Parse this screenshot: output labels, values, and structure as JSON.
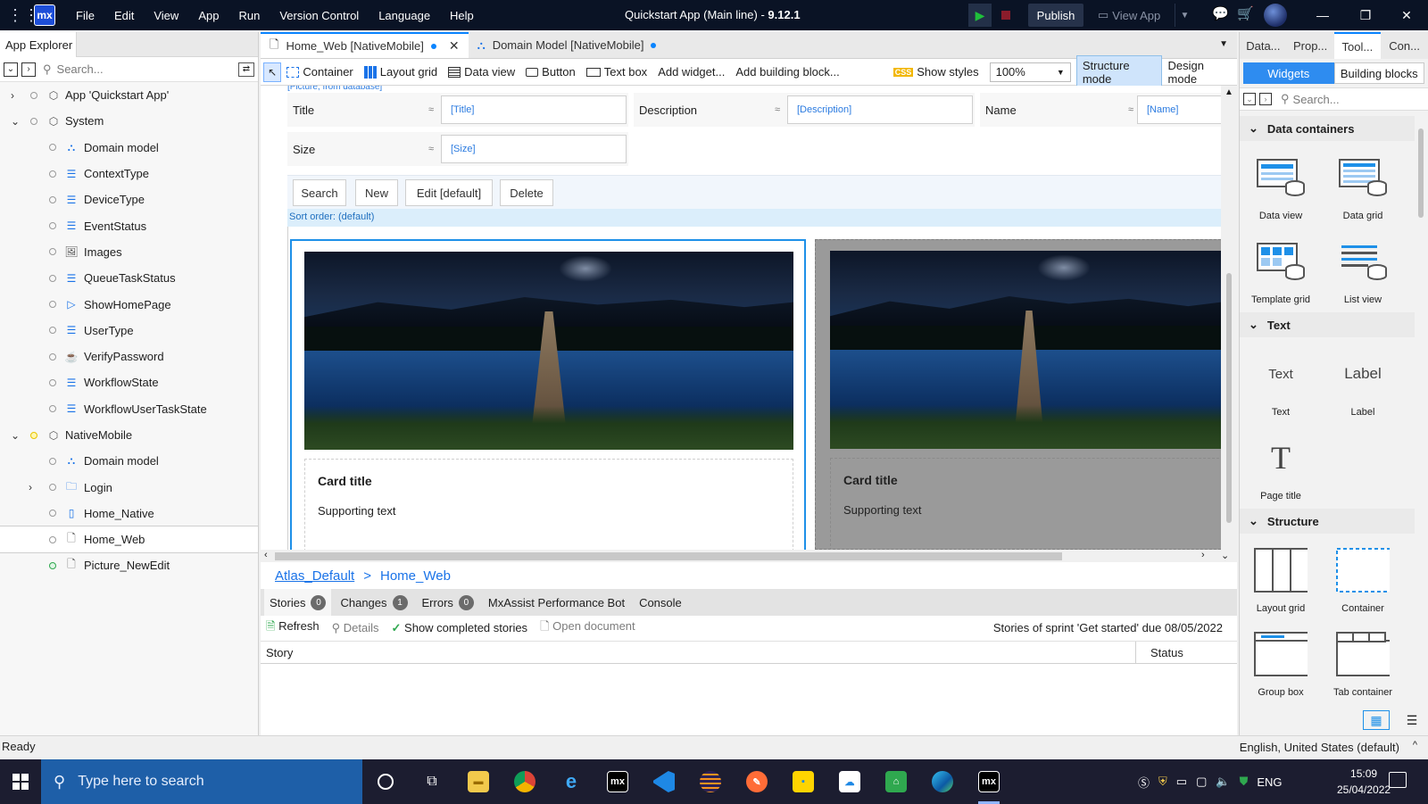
{
  "titlebar": {
    "logo": "mx",
    "menu": [
      "File",
      "Edit",
      "View",
      "App",
      "Run",
      "Version Control",
      "Language",
      "Help"
    ],
    "app_title": "Quickstart App (Main line)",
    "version": "9.12.1",
    "publish": "Publish",
    "view_app": "View App"
  },
  "explorer": {
    "tab": "App Explorer",
    "search_placeholder": "Search...",
    "items": [
      {
        "label": "App 'Quickstart App'",
        "icon": "app-icon"
      },
      {
        "label": "System",
        "icon": "module-icon"
      },
      {
        "label": "Domain model",
        "icon": "domain-model-icon"
      },
      {
        "label": "ContextType",
        "icon": "enumeration-icon"
      },
      {
        "label": "DeviceType",
        "icon": "enumeration-icon"
      },
      {
        "label": "EventStatus",
        "icon": "enumeration-icon"
      },
      {
        "label": "Images",
        "icon": "image-collection-icon"
      },
      {
        "label": "QueueTaskStatus",
        "icon": "enumeration-icon"
      },
      {
        "label": "ShowHomePage",
        "icon": "microflow-icon"
      },
      {
        "label": "UserType",
        "icon": "enumeration-icon"
      },
      {
        "label": "VerifyPassword",
        "icon": "java-action-icon"
      },
      {
        "label": "WorkflowState",
        "icon": "enumeration-icon"
      },
      {
        "label": "WorkflowUserTaskState",
        "icon": "enumeration-icon"
      },
      {
        "label": "NativeMobile",
        "icon": "module-icon"
      },
      {
        "label": "Domain model",
        "icon": "domain-model-icon"
      },
      {
        "label": "Login",
        "icon": "folder-icon"
      },
      {
        "label": "Home_Native",
        "icon": "native-page-icon"
      },
      {
        "label": "Home_Web",
        "icon": "page-icon"
      },
      {
        "label": "Picture_NewEdit",
        "icon": "page-icon"
      }
    ]
  },
  "doc_tabs": [
    {
      "label": "Home_Web [NativeMobile]"
    },
    {
      "label": "Domain Model [NativeMobile]"
    }
  ],
  "toolbar": {
    "container": "Container",
    "layout_grid": "Layout grid",
    "data_view": "Data view",
    "button": "Button",
    "text_box": "Text box",
    "add_widget": "Add widget...",
    "add_block": "Add building block...",
    "show_styles": "Show styles",
    "css_badge": "CSS",
    "zoom": "100%",
    "structure_mode": "Structure mode",
    "design_mode": "Design mode"
  },
  "canvas": {
    "top_strip": "[Picture, from database]",
    "fields": [
      {
        "label": "Title",
        "value": "[Title]"
      },
      {
        "label": "Description",
        "value": "[Description]"
      },
      {
        "label": "Name",
        "value": "[Name]"
      },
      {
        "label": "Size",
        "value": "[Size]"
      }
    ],
    "eq": "≈",
    "buttons": [
      "Search",
      "New",
      "Edit [default]",
      "Delete"
    ],
    "sort_order": "Sort order: (default)",
    "cards": [
      {
        "title": "Card title",
        "text": "Supporting text"
      },
      {
        "title": "Card title",
        "text": "Supporting text"
      }
    ]
  },
  "breadcrumb": [
    "Atlas_Default",
    ">",
    "Home_Web"
  ],
  "stories": {
    "tabs": [
      {
        "label": "Stories",
        "count": "0"
      },
      {
        "label": "Changes",
        "count": "1"
      },
      {
        "label": "Errors",
        "count": "0"
      },
      {
        "label": "MxAssist Performance Bot",
        "count": null
      },
      {
        "label": "Console",
        "count": null
      }
    ],
    "refresh": "Refresh",
    "details": "Details",
    "show_completed": "Show completed stories",
    "open_document": "Open document",
    "sprint": "Stories of sprint 'Get started' due 08/05/2022",
    "col_story": "Story",
    "col_status": "Status"
  },
  "rpanel": {
    "tabs": [
      "Data...",
      "Prop...",
      "Tool...",
      "Con..."
    ],
    "segments": [
      "Widgets",
      "Building blocks"
    ],
    "search_placeholder": "Search...",
    "categories": [
      {
        "name": "Data containers",
        "items": [
          "Data view",
          "Data grid",
          "Template grid",
          "List view"
        ]
      },
      {
        "name": "Text",
        "items": [
          "Text",
          "Label",
          "Page title"
        ]
      },
      {
        "name": "Structure",
        "items": [
          "Layout grid",
          "Container",
          "Group box",
          "Tab container"
        ]
      }
    ],
    "text_preview": "Text",
    "label_preview": "Label",
    "page_title_preview": "T"
  },
  "statusbar": {
    "left": "Ready",
    "right": "English, United States (default)"
  },
  "taskbar": {
    "search": "Type here to search",
    "lang": "ENG",
    "time": "15:09",
    "date": "25/04/2022"
  },
  "colors": {
    "accent": "#0a84ff",
    "titlebar": "#0a1325",
    "taskbar": "#1c1d30",
    "taskbar_search": "#1e5fa8"
  }
}
